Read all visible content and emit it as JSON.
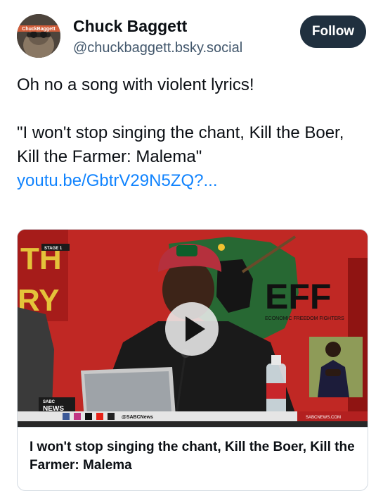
{
  "post": {
    "author": {
      "display_name": "Chuck Baggett",
      "handle": "@chuckbaggett.bsky.social",
      "avatar_label": "ChuckBaggett"
    },
    "follow_label": "Follow",
    "text_line_1": "Oh no a song with violent lyrics!",
    "text_line_2": "\"I won't stop singing the chant, Kill the Boer, Kill the Farmer: Malema\"",
    "link_text": "youtu.be/GbtrV29N5ZQ?..."
  },
  "embed": {
    "title": "I won't stop singing the chant, Kill the Boer, Kill the Farmer: Malema",
    "thumbnail": {
      "banner_left_1": "TH",
      "banner_left_2": "RY",
      "stage_tag": "STAGE 1",
      "party_logo": "EFF",
      "party_subtitle": "ECONOMIC FREEDOM FIGHTERS",
      "news_logo_top": "SABC",
      "news_logo_bottom": "NEWS",
      "social_handle": "@SABCNews",
      "site": "SABCNEWS.COM"
    },
    "icons": {
      "play": "play-icon"
    }
  }
}
